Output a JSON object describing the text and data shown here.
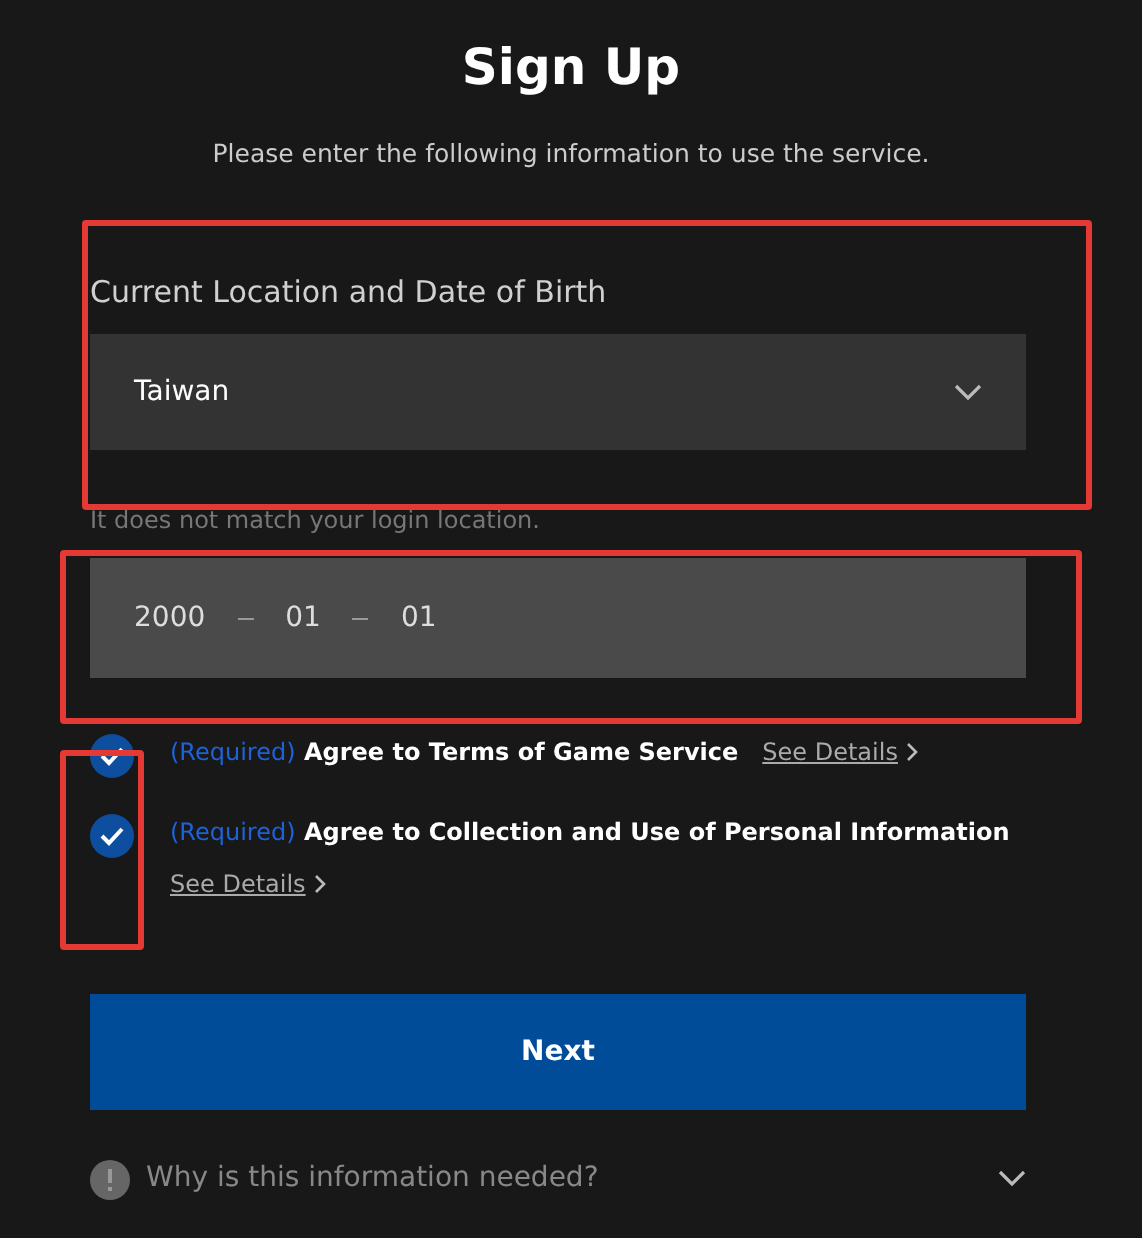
{
  "title": "Sign Up",
  "subtitle": "Please enter the following information to use the service.",
  "location": {
    "label": "Current Location and Date of Birth",
    "value": "Taiwan",
    "warning": "It does not match your login location."
  },
  "birth_date": {
    "year": "2000",
    "month": "01",
    "day": "01"
  },
  "agreements": [
    {
      "checked": true,
      "tag": "(Required)",
      "text": "Agree to Terms of Game Service",
      "link": "See Details",
      "link_wraps": false
    },
    {
      "checked": true,
      "tag": "(Required)",
      "text": "Agree to Collection and Use of Personal Information",
      "link": "See Details",
      "link_wraps": true
    }
  ],
  "next_button": "Next",
  "faq": {
    "question": "Why is this information needed?",
    "expanded": false
  }
}
